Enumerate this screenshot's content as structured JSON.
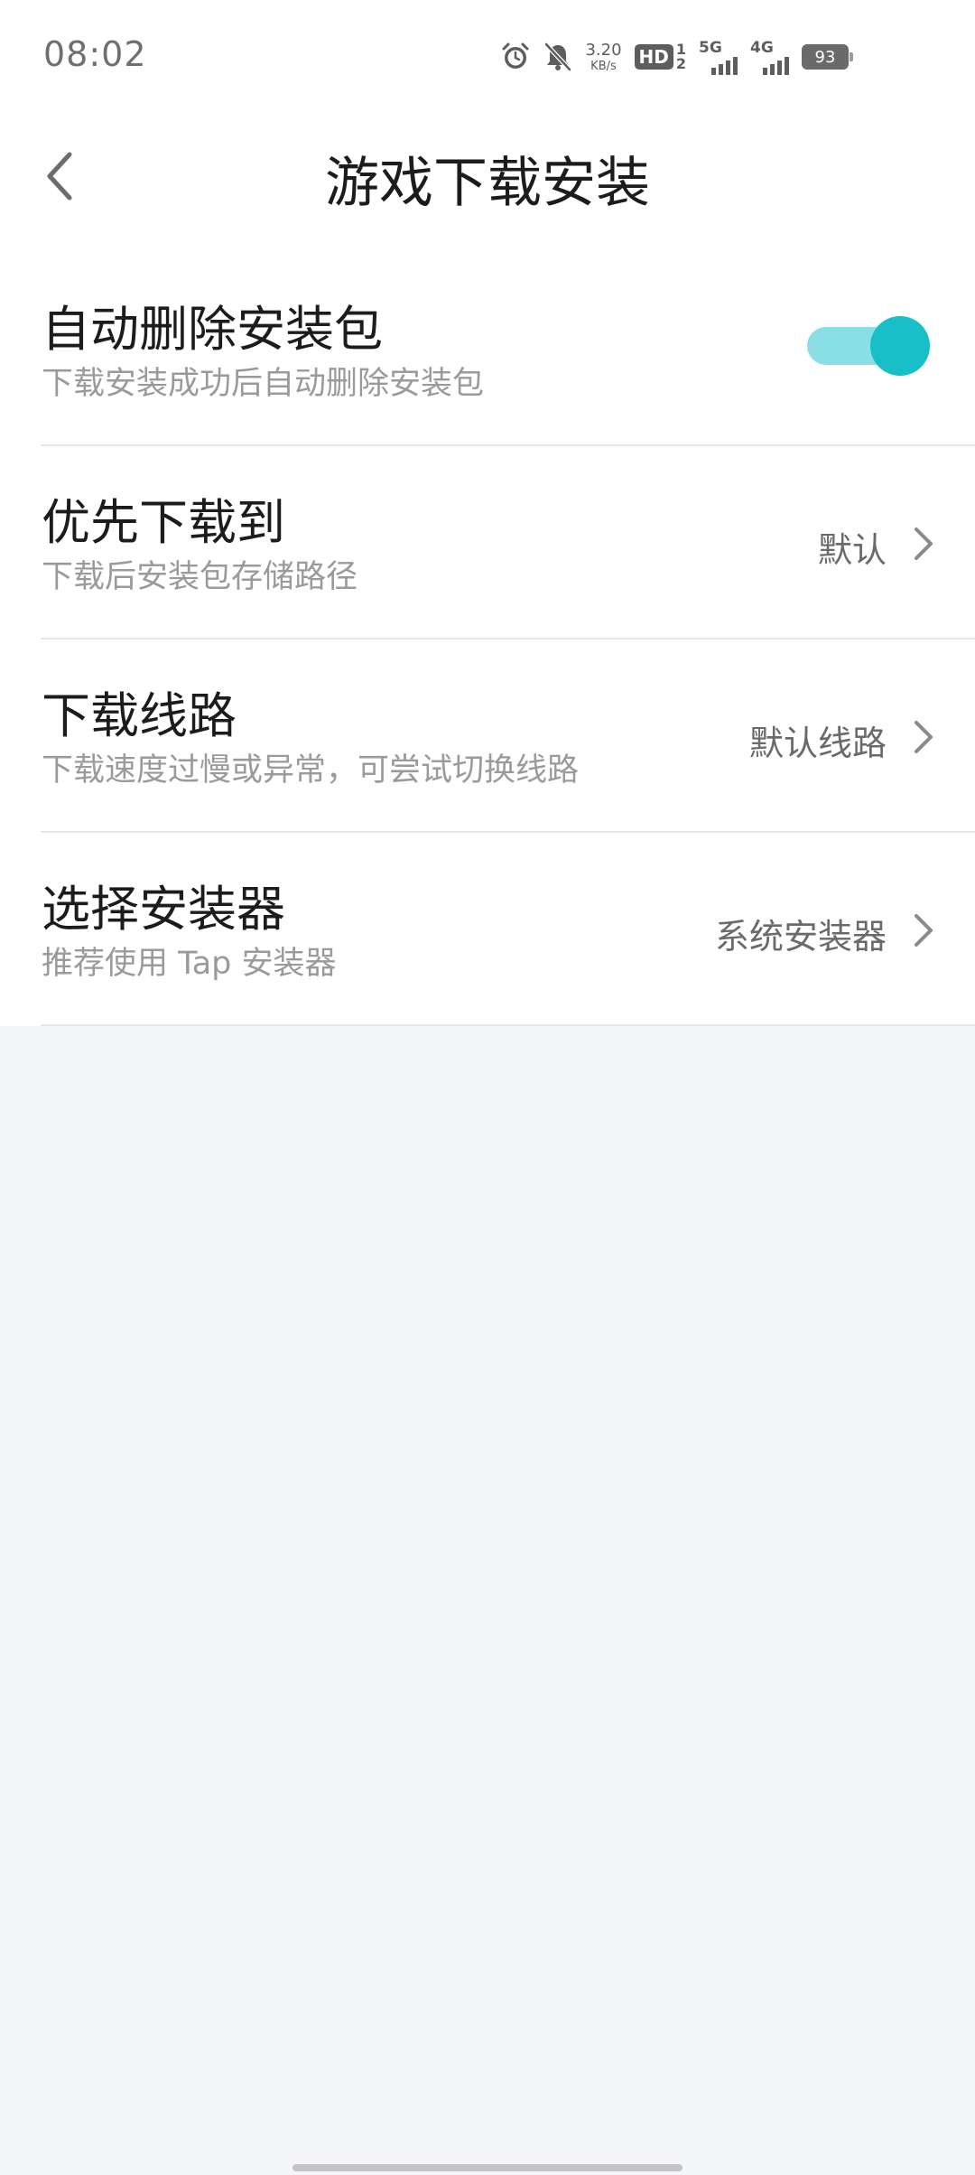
{
  "status_bar": {
    "time": "08:02",
    "net_speed_value": "3.20",
    "net_speed_unit": "KB/s",
    "hd_label": "HD",
    "hd_sub_top": "1",
    "hd_sub_bottom": "2",
    "network_5g": "5G",
    "network_4g": "4G",
    "battery": "93"
  },
  "header": {
    "title": "游戏下载安装"
  },
  "settings": [
    {
      "title": "自动删除安装包",
      "subtitle": "下载安装成功后自动删除安装包",
      "toggle_on": true
    },
    {
      "title": "优先下载到",
      "subtitle": "下载后安装包存储路径",
      "value": "默认"
    },
    {
      "title": "下载线路",
      "subtitle": "下载速度过慢或异常，可尝试切换线路",
      "value": "默认线路"
    },
    {
      "title": "选择安装器",
      "subtitle": "推荐使用 Tap 安装器",
      "value": "系统安装器"
    }
  ],
  "colors": {
    "accent": "#18bec8",
    "accent_track": "#8adfe6",
    "page_bg": "#f4f5f7"
  }
}
